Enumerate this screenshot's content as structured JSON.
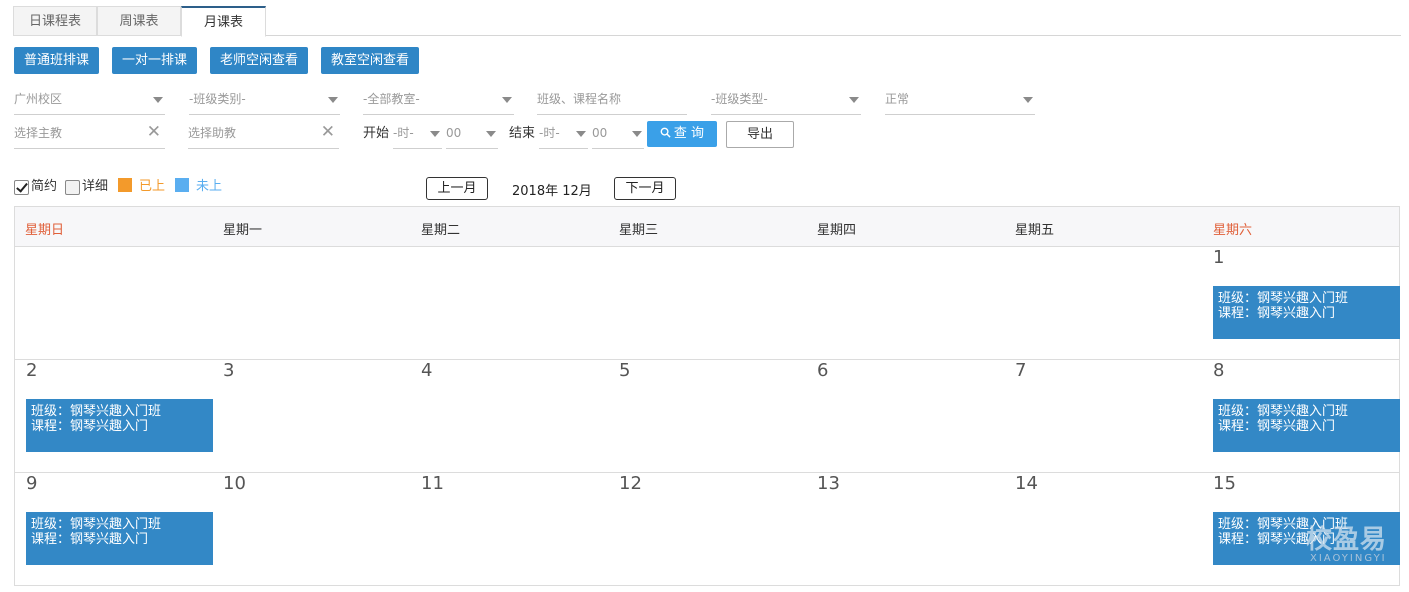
{
  "tabs": [
    "日课程表",
    "周课表",
    "月课表"
  ],
  "actions": {
    "regular_schedule": "普通班排课",
    "one_on_one": "一对一排课",
    "teacher_free": "老师空闲查看",
    "classroom_free": "教室空闲查看"
  },
  "filters": {
    "campus": "广州校区",
    "class_category": "-班级类别-",
    "classroom": "-全部教室-",
    "class_course_placeholder": "班级、课程名称",
    "class_type": "-班级类型-",
    "status": "正常",
    "main_teacher_placeholder": "选择主教",
    "assistant_placeholder": "选择助教",
    "start_label": "开始",
    "end_label": "结束",
    "hour_placeholder": "-时-",
    "minute_value": "00",
    "query_button": "查 询",
    "export_button": "导出"
  },
  "view_options": {
    "brief": "简约",
    "brief_checked": true,
    "detail": "详细",
    "detail_checked": false
  },
  "legend": {
    "done": {
      "label": "已上",
      "color": "#f39a2b"
    },
    "pending": {
      "label": "未上",
      "color": "#5aaef0"
    }
  },
  "nav": {
    "prev": "上一月",
    "current": "2018年 12月",
    "next": "下一月"
  },
  "weekdays": [
    "星期日",
    "星期一",
    "星期二",
    "星期三",
    "星期四",
    "星期五",
    "星期六"
  ],
  "weeks": [
    [
      "",
      "",
      "",
      "",
      "",
      "",
      "1"
    ],
    [
      "2",
      "3",
      "4",
      "5",
      "6",
      "7",
      "8"
    ],
    [
      "9",
      "10",
      "11",
      "12",
      "13",
      "14",
      "15"
    ]
  ],
  "event": {
    "class_line": "班级：钢琴兴趣入门班",
    "course_line": "课程：钢琴兴趣入门"
  },
  "events_on": [
    "1",
    "2",
    "8",
    "9",
    "15"
  ],
  "watermark": {
    "main": "校盈易",
    "sub": "XIAOYINGYI"
  },
  "colors": {
    "primary": "#2f86c6",
    "event": "#3388c6",
    "query": "#3aa0e8",
    "weekend": "#e0603a"
  }
}
